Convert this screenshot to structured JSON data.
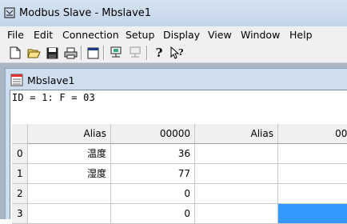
{
  "window": {
    "title": "Modbus Slave - Mbslave1"
  },
  "menu": [
    "File",
    "Edit",
    "Connection",
    "Setup",
    "Display",
    "View",
    "Window",
    "Help"
  ],
  "toolbar_icons": [
    "new-document-icon",
    "open-folder-icon",
    "save-icon",
    "print-icon",
    "window-icon",
    "connect-icon",
    "disconnect-icon",
    "help-icon",
    "context-help-icon"
  ],
  "child": {
    "title": "Mbslave1",
    "info": "ID = 1: F = 03",
    "headers": [
      "Alias",
      "00000",
      "Alias",
      "000"
    ],
    "rows": [
      {
        "num": "0",
        "alias": "温度",
        "value": "36"
      },
      {
        "num": "1",
        "alias": "湿度",
        "value": "77"
      },
      {
        "num": "2",
        "alias": "",
        "value": "0"
      },
      {
        "num": "3",
        "alias": "",
        "value": "0"
      }
    ]
  },
  "colors": {
    "title_bar": "#c4d6ea",
    "selection": "#3399ff",
    "mdi_background": "#abb6c4"
  }
}
